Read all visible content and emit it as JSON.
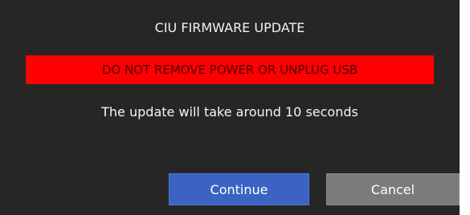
{
  "dialog": {
    "title": "CIU FIRMWARE UPDATE",
    "warning": "DO NOT REMOVE POWER OR UNPLUG USB",
    "message": "The update will take around 10 seconds",
    "buttons": {
      "continue_label": "Continue",
      "cancel_label": "Cancel"
    }
  },
  "colors": {
    "background": "#262626",
    "warning_background": "#ff0000",
    "warning_text": "#4a0000",
    "continue_button": "#3a63c3",
    "cancel_button": "#7b7b7b"
  }
}
